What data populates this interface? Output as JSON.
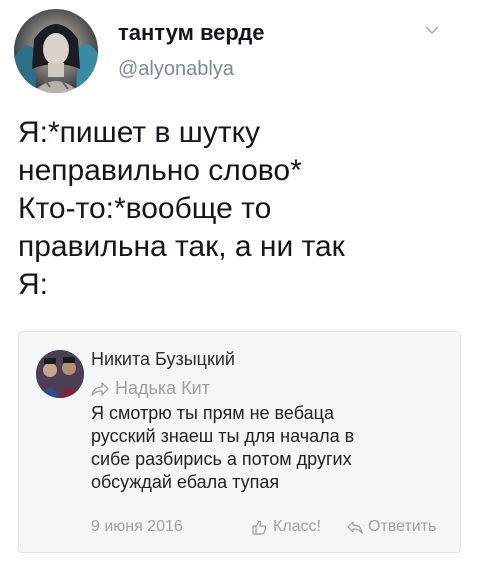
{
  "tweet": {
    "display_name": "тантум верде",
    "handle": "@alyonablya",
    "lines": [
      "Я:*пишет в шутку",
      "неправильно слово*",
      "Кто-то:*вообще то",
      "правильна так, а ни так",
      "Я:"
    ]
  },
  "comment": {
    "author": "Никита Бузыцкий",
    "reply_to": "Надька Кит",
    "lines": [
      "Я смотрю ты прям не вебаца",
      "русский знаеш ты для начала в",
      "сибе разбирись а потом других",
      "обсуждай ебала тупая"
    ],
    "date": "9 июня 2016",
    "like_label": "Класс!",
    "answer_label": "Ответить"
  },
  "icons": {
    "chevron": "chevron-down-icon",
    "reply_arrow": "reply-arrow-icon",
    "like": "thumbs-up-icon",
    "answer": "reply-icon"
  }
}
